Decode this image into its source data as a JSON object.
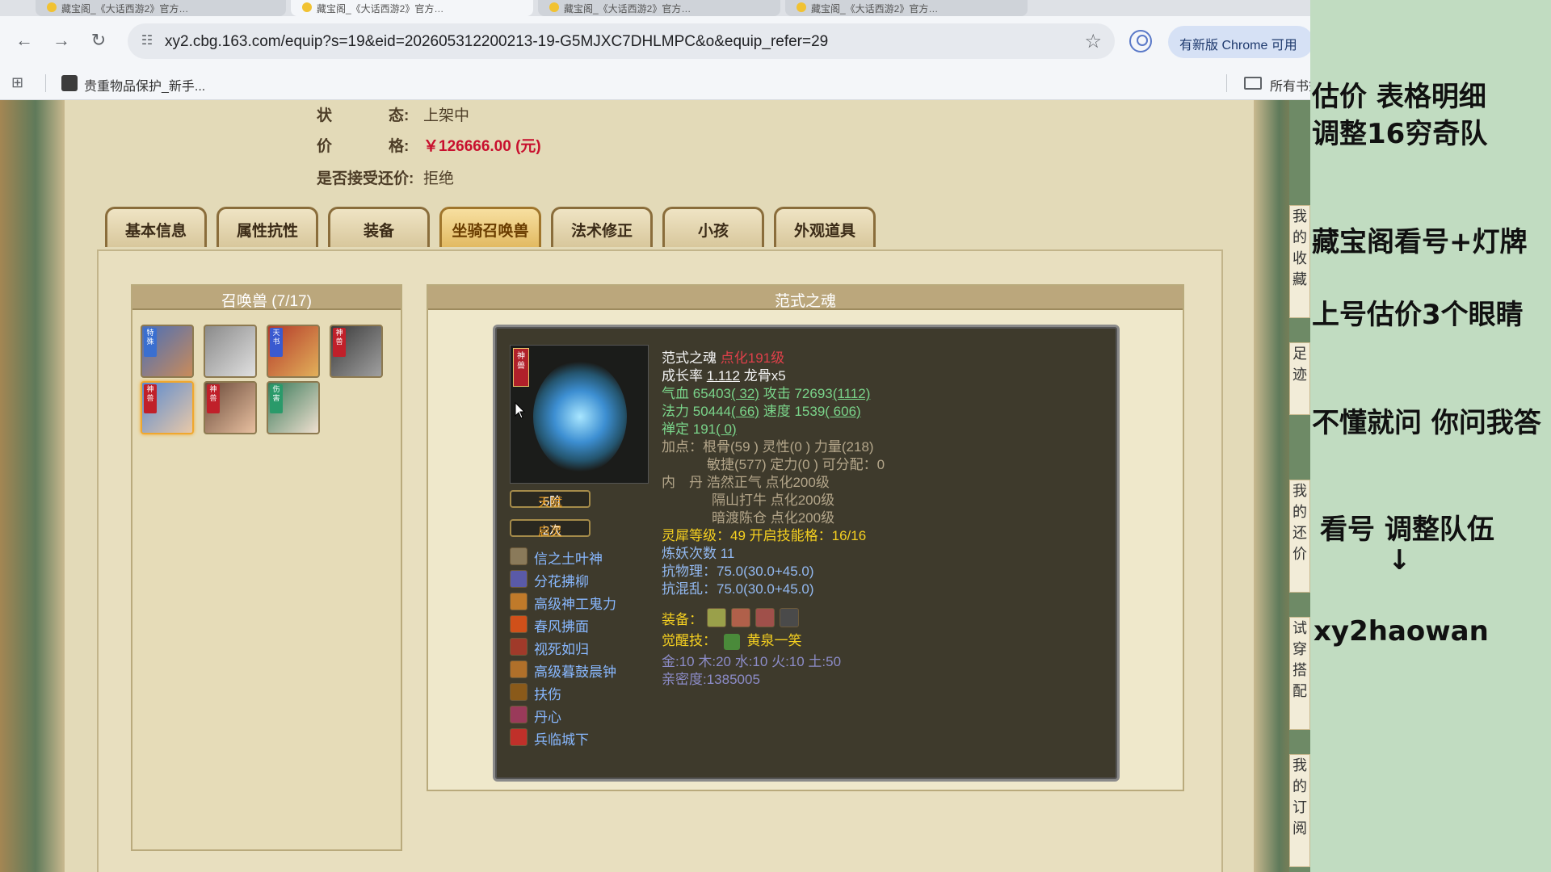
{
  "browser": {
    "tabs": [
      {
        "title": "藏宝阁_《大话西游2》官方…",
        "active": false
      },
      {
        "title": "藏宝阁_《大话西游2》官方…",
        "active": true
      },
      {
        "title": "藏宝阁_《大话西游2》官方…",
        "active": false
      },
      {
        "title": "藏宝阁_《大话西游2》官方…",
        "active": false
      }
    ],
    "url": "xy2.cbg.163.com/equip?s=19&eid=202605312200213-19-G5MJXC7DHLMPC&o&equip_refer=29",
    "update_chip": "有新版 Chrome 可用",
    "bookmark": "贵重物品保护_新手...",
    "bookmark_folder": "所有书签"
  },
  "listing": {
    "status_label_a": "状",
    "status_label_b": "态:",
    "status_value": "上架中",
    "price_label_a": "价",
    "price_label_b": "格:",
    "price_value": "￥126666.00 (元)",
    "counter_label": "是否接受还价:",
    "counter_value": "拒绝"
  },
  "tabs": [
    "基本信息",
    "属性抗性",
    "装备",
    "坐骑召唤兽",
    "法术修正",
    "小孩",
    "外观道具"
  ],
  "active_tab": "坐骑召唤兽",
  "pets": {
    "header": "召唤兽 (7/17)",
    "badges": [
      "特殊",
      "",
      "天书",
      "神兽",
      "神兽",
      "神兽",
      "伤害"
    ]
  },
  "soul": {
    "header": "范式之魂",
    "portrait_badge": "神兽",
    "talent_label": "天赋",
    "talent_value": "·5阶",
    "awaken_label": "启灵",
    "awaken_value": "·2次",
    "skills": [
      "信之土叶神",
      "分花拂柳",
      "高级神工鬼力",
      "春风拂面",
      "视死如归",
      "高级暮鼓晨钟",
      "扶伤",
      "丹心",
      "兵临城下"
    ],
    "name": "范式之魂",
    "level": "点化191级",
    "growth_label": "成长率",
    "growth_value": "1.112",
    "bone": "龙骨x5",
    "hp_label": "气血",
    "hp_value": "65403",
    "hp_bonus": "( 32)",
    "atk_label": "攻击",
    "atk_value": "72693",
    "atk_bonus": "(1112)",
    "mp_label": "法力",
    "mp_value": "50444",
    "mp_bonus": "( 66)",
    "spd_label": "速度",
    "spd_value": "1539",
    "spd_bonus": "( 606)",
    "zen_label": "禅定",
    "zen_value": "191",
    "zen_bonus": "( 0)",
    "points_line1": "加点：根骨(59 ) 灵性(0 ) 力量(218)",
    "points_line2": "敏捷(577) 定力(0 ) 可分配：0",
    "dan_label": "内　丹",
    "dan_1": "浩然正气 点化200级",
    "dan_2": "隔山打牛 点化200级",
    "dan_3": "暗渡陈仓 点化200级",
    "xi_line": "灵犀等级：49 开启技能格：16/16",
    "lianyao": "炼妖次数 11",
    "resist_phys": "抗物理：75.0(30.0+45.0)",
    "resist_chaos": "抗混乱：75.0(30.0+45.0)",
    "equip_label": "装备：",
    "awaken_skill_label": "觉醒技：",
    "awaken_skill": "黄泉一笑",
    "elements": "金:10 木:20 水:10 火:10 土:50",
    "intimacy": "亲密度:1385005"
  },
  "side_strip": [
    "我\n的\n收\n藏",
    "足\n迹",
    "我\n的\n还\n价",
    "试\n穿\n搭\n配",
    "我\n的\n订\n阅"
  ],
  "overlay": {
    "lines": [
      "估价 表格明细",
      "调整16穷奇队",
      "藏宝阁看号+灯牌",
      "上号估价3个眼睛",
      "不懂就问 你问我答",
      "看号 调整队伍",
      "↓",
      "xy2haowan"
    ]
  },
  "colors": {
    "price": "#c8102e",
    "overlay_bg": "#c1dcc1",
    "card_bg": "#3e3a2c"
  }
}
